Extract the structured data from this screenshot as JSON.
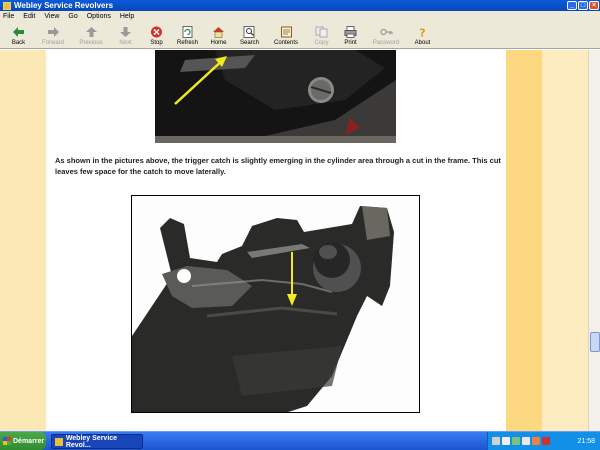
{
  "window": {
    "title": "Webley Service Revolvers"
  },
  "menu": [
    "File",
    "Edit",
    "View",
    "Go",
    "Options",
    "Help"
  ],
  "toolbar": [
    {
      "label": "Back",
      "icon": "back-arrow-icon",
      "enabled": true
    },
    {
      "label": "Forward",
      "icon": "forward-arrow-icon",
      "enabled": false
    },
    {
      "label": "Previous",
      "icon": "previous-arrow-icon",
      "enabled": false
    },
    {
      "label": "Next",
      "icon": "next-arrow-icon",
      "enabled": false
    },
    {
      "label": "Stop",
      "icon": "stop-icon",
      "enabled": true
    },
    {
      "label": "Refresh",
      "icon": "refresh-icon",
      "enabled": true
    },
    {
      "label": "Home",
      "icon": "home-icon",
      "enabled": true
    },
    {
      "label": "Search",
      "icon": "search-icon",
      "enabled": true
    },
    {
      "label": "Contents",
      "icon": "contents-icon",
      "enabled": true
    },
    {
      "label": "Copy",
      "icon": "copy-icon",
      "enabled": false
    },
    {
      "label": "Print",
      "icon": "print-icon",
      "enabled": true
    },
    {
      "label": "Password",
      "icon": "key-icon",
      "enabled": false
    },
    {
      "label": "About",
      "icon": "about-icon",
      "enabled": true
    }
  ],
  "content": {
    "caption": "As shown in the pictures above, the trigger catch is slightly emerging in the cylinder area through a cut in the frame. This cut leaves few space for the catch to move laterally."
  },
  "taskbar": {
    "start_label": "Démarrer",
    "task_label": "Webley Service Revol...",
    "clock": "21:58"
  },
  "colors": {
    "accent_arrow": "#f2ea1a",
    "stripe_orange": "#fcd880",
    "stripe_light": "#fce8b4"
  }
}
